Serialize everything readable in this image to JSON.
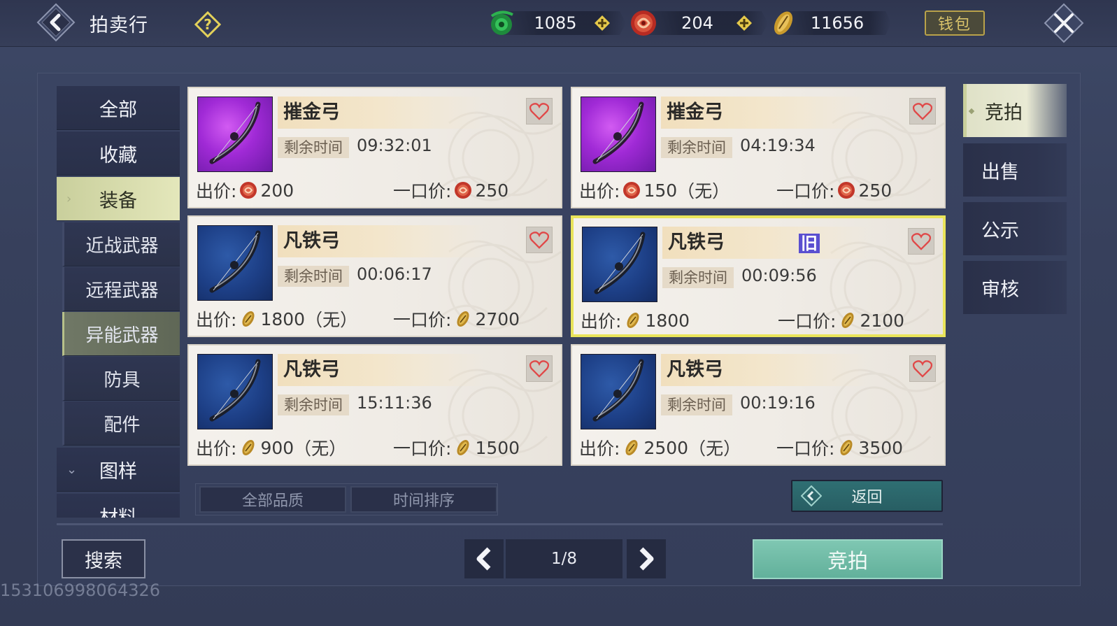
{
  "header": {
    "title": "拍卖行",
    "currencies": [
      {
        "name": "jade",
        "icon": "jade-coin-icon",
        "value": "1085",
        "has_plus": true
      },
      {
        "name": "red",
        "icon": "red-swirl-coin-icon",
        "value": "204",
        "has_plus": true
      },
      {
        "name": "gold",
        "icon": "gold-shell-coin-icon",
        "value": "11656",
        "has_plus": false
      }
    ],
    "wallet_label": "钱包"
  },
  "categories": [
    {
      "label": "全部",
      "type": "top"
    },
    {
      "label": "收藏",
      "type": "top"
    },
    {
      "label": "装备",
      "type": "top",
      "active": true
    },
    {
      "label": "近战武器",
      "type": "sub"
    },
    {
      "label": "远程武器",
      "type": "sub"
    },
    {
      "label": "异能武器",
      "type": "sub",
      "active": true
    },
    {
      "label": "防具",
      "type": "sub"
    },
    {
      "label": "配件",
      "type": "sub"
    },
    {
      "label": "图样",
      "type": "top",
      "chevron": true
    },
    {
      "label": "材料",
      "type": "top"
    }
  ],
  "listings": [
    {
      "name": "摧金弓",
      "quality": "purple",
      "time_label": "剩余时间",
      "time": "09:32:01",
      "bid_label": "出价:",
      "bid_currency": "red",
      "bid": "200",
      "bid_note": "",
      "buy_label": "一口价:",
      "buy_currency": "red",
      "buy": "250",
      "selected": false,
      "tag": ""
    },
    {
      "name": "摧金弓",
      "quality": "purple",
      "time_label": "剩余时间",
      "time": "04:19:34",
      "bid_label": "出价:",
      "bid_currency": "red",
      "bid": "150",
      "bid_note": "（无）",
      "buy_label": "一口价:",
      "buy_currency": "red",
      "buy": "250",
      "selected": false,
      "tag": ""
    },
    {
      "name": "凡铁弓",
      "quality": "blue",
      "time_label": "剩余时间",
      "time": "00:06:17",
      "bid_label": "出价:",
      "bid_currency": "gold",
      "bid": "1800",
      "bid_note": "（无）",
      "buy_label": "一口价:",
      "buy_currency": "gold",
      "buy": "2700",
      "selected": false,
      "tag": ""
    },
    {
      "name": "凡铁弓",
      "quality": "blue",
      "time_label": "剩余时间",
      "time": "00:09:56",
      "bid_label": "出价:",
      "bid_currency": "gold",
      "bid": "1800",
      "bid_note": "",
      "buy_label": "一口价:",
      "buy_currency": "gold",
      "buy": "2100",
      "selected": true,
      "tag": "旧"
    },
    {
      "name": "凡铁弓",
      "quality": "blue",
      "time_label": "剩余时间",
      "time": "15:11:36",
      "bid_label": "出价:",
      "bid_currency": "gold",
      "bid": "900",
      "bid_note": "（无）",
      "buy_label": "一口价:",
      "buy_currency": "gold",
      "buy": "1500",
      "selected": false,
      "tag": ""
    },
    {
      "name": "凡铁弓",
      "quality": "blue",
      "time_label": "剩余时间",
      "time": "00:19:16",
      "bid_label": "出价:",
      "bid_currency": "gold",
      "bid": "2500",
      "bid_note": "（无）",
      "buy_label": "一口价:",
      "buy_currency": "gold",
      "buy": "3500",
      "selected": false,
      "tag": ""
    }
  ],
  "right_tabs": [
    {
      "label": "竞拍",
      "active": true
    },
    {
      "label": "出售"
    },
    {
      "label": "公示"
    },
    {
      "label": "审核"
    }
  ],
  "filters": {
    "quality": "全部品质",
    "sort": "时间排序"
  },
  "return_label": "返回",
  "search_label": "搜索",
  "pager": {
    "current": "1/8"
  },
  "bid_button_label": "竞拍",
  "user_id": "153106998064326",
  "colors": {
    "accent_green": "#62b09b",
    "selected_border": "#e9e45a",
    "active_tab": "#e4e7bb"
  }
}
